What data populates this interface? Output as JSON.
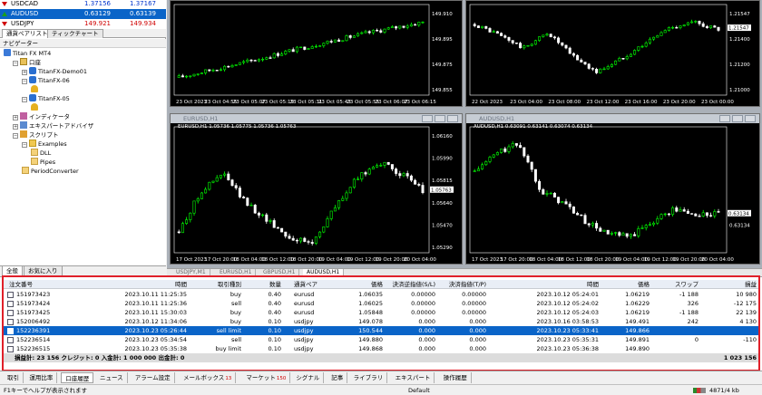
{
  "market_watch": {
    "rows": [
      {
        "symbol": "USDCAD",
        "bid": "1.37156",
        "ask": "1.37167",
        "dir": "down",
        "bid_color": "blue",
        "ask_color": "blue"
      },
      {
        "symbol": "AUDUSD",
        "bid": "0.63129",
        "ask": "0.63139",
        "dir": "up",
        "bid_color": "blue",
        "ask_color": "blue",
        "selected": true
      },
      {
        "symbol": "USDJPY",
        "bid": "149.921",
        "ask": "149.934",
        "dir": "down",
        "bid_color": "red",
        "ask_color": "red"
      }
    ],
    "tabs": [
      "通貨ペアリスト",
      "ティックチャート"
    ]
  },
  "navigator": {
    "title": "ナビゲーター",
    "tree": [
      {
        "label": "Titan FX MT4",
        "level": 0,
        "icon": "terminal-icon",
        "expander": ""
      },
      {
        "label": "口座",
        "level": 1,
        "icon": "accounts-icon",
        "expander": "−"
      },
      {
        "label": "TitanFX-Demo01",
        "level": 2,
        "icon": "server-icon",
        "expander": "+"
      },
      {
        "label": "TitanFX-06",
        "level": 2,
        "icon": "server-icon",
        "expander": "−"
      },
      {
        "label": "",
        "level": 3,
        "icon": "user-icon",
        "expander": ""
      },
      {
        "label": "TitanFX-05",
        "level": 2,
        "icon": "server-icon",
        "expander": "−"
      },
      {
        "label": "",
        "level": 3,
        "icon": "user-icon",
        "expander": ""
      },
      {
        "label": "インディケータ",
        "level": 1,
        "icon": "indicator-icon",
        "expander": "+"
      },
      {
        "label": "エキスパートアドバイザ",
        "level": 1,
        "icon": "expert-icon",
        "expander": "+"
      },
      {
        "label": "スクリプト",
        "level": 1,
        "icon": "script-icon",
        "expander": "−"
      },
      {
        "label": "Examples",
        "level": 2,
        "icon": "folder-icon",
        "expander": "−"
      },
      {
        "label": "DLL",
        "level": 3,
        "icon": "script-item-icon",
        "expander": ""
      },
      {
        "label": "Pipes",
        "level": 3,
        "icon": "script-item-icon",
        "expander": ""
      },
      {
        "label": "PeriodConverter",
        "level": 2,
        "icon": "script-item-icon",
        "expander": ""
      }
    ],
    "tabs": [
      "全般",
      "お気に入り"
    ]
  },
  "charts": [
    {
      "title": "",
      "ohlc": "",
      "time_labels": [
        "23 Oct 2023",
        "23 Oct 04:55",
        "23 Oct 05:07",
        "23 Oct 05:19",
        "23 Oct 05:31",
        "23 Oct 05:43",
        "23 Oct 05:55",
        "23 Oct 06:07",
        "23 Oct 06:15"
      ],
      "price_labels": [
        "149.910",
        "149.895",
        "149.875",
        "149.855"
      ],
      "current_price": "",
      "chart_data": {
        "type": "candlestick",
        "y_range": [
          149.845,
          149.925
        ],
        "trend": [
          149.862,
          149.868,
          149.874,
          149.88,
          149.887,
          149.893,
          149.899,
          149.905,
          149.91,
          149.915
        ],
        "current": null
      }
    },
    {
      "title": "",
      "ohlc": "",
      "time_labels": [
        "22 Oct 2023",
        "23 Oct 04:00",
        "23 Oct 08:00",
        "23 Oct 12:00",
        "23 Oct 16:00",
        "23 Oct 20:00",
        "23 Oct 00:00"
      ],
      "price_labels": [
        "1.21547",
        "1.21400",
        "1.21200",
        "1.21000"
      ],
      "current_price": "1.21547",
      "chart_data": {
        "type": "candlestick",
        "y_range": [
          1.209,
          1.217
        ],
        "trend": [
          1.2158,
          1.2148,
          1.2135,
          1.215,
          1.2128,
          1.2112,
          1.2125,
          1.214,
          1.2155,
          1.216,
          1.2153
        ],
        "current": 1.21547
      }
    },
    {
      "title": "EURUSD,H1",
      "ohlc": "EURUSD,H1  1.05736 1.05775 1.05736 1.05763",
      "time_labels": [
        "17 Oct 2023",
        "17 Oct 20:00",
        "18 Oct 04:00",
        "18 Oct 12:00",
        "18 Oct 20:00",
        "19 Oct 04:00",
        "19 Oct 12:00",
        "19 Oct 20:00",
        "20 Oct 04:00"
      ],
      "price_labels": [
        "1.06160",
        "1.05990",
        "1.05815",
        "1.05640",
        "1.05470",
        "1.05290"
      ],
      "current_price": "1.05763",
      "chart_data": {
        "type": "candlestick",
        "y_range": [
          1.0522,
          1.0624
        ],
        "trend": [
          1.054,
          1.0575,
          1.059,
          1.0565,
          1.055,
          1.0535,
          1.053,
          1.056,
          1.0585,
          1.06,
          1.059,
          1.0576
        ],
        "current": 1.05763
      }
    },
    {
      "title": "AUDUSD,H1",
      "ohlc": "AUDUSD,H1  0.63091 0.63141 0.63074 0.63134",
      "time_labels": [
        "17 Oct 2023",
        "17 Oct 20:00",
        "18 Oct 04:00",
        "18 Oct 12:00",
        "18 Oct 20:00",
        "19 Oct 04:00",
        "19 Oct 12:00",
        "19 Oct 20:00",
        "20 Oct 04:00"
      ],
      "price_labels": [
        "",
        "",
        "",
        "",
        "0.63134",
        ""
      ],
      "current_price": "0.63134",
      "chart_data": {
        "type": "candlestick",
        "y_range": [
          0.625,
          0.644
        ],
        "trend": [
          0.638,
          0.641,
          0.6425,
          0.635,
          0.633,
          0.63,
          0.628,
          0.6275,
          0.63,
          0.632,
          0.631,
          0.6313
        ],
        "current": 0.63134
      }
    }
  ],
  "chart_tabs": [
    "USDJPY,M1",
    "EURUSD,H1",
    "GBPUSD,H1",
    "AUDUSD,H1"
  ],
  "history": {
    "columns": [
      "注文番号",
      "時間",
      "取引種別",
      "数量",
      "通貨ペア",
      "価格",
      "決済逆指値(S/L)",
      "決済指値(T/P)",
      "時間",
      "価格",
      "スワップ",
      "損益"
    ],
    "rows": [
      {
        "id": "151973423",
        "open_time": "2023.10.11 11:25:35",
        "type": "buy",
        "size": "0.40",
        "symbol": "eurusd",
        "price": "1.06035",
        "sl": "0.00000",
        "tp": "0.00000",
        "close_time": "2023.10.12 05:24:01",
        "close_price": "1.06219",
        "swap": "-1 188",
        "profit": "10 980"
      },
      {
        "id": "151973424",
        "open_time": "2023.10.11 11:25:36",
        "type": "sell",
        "size": "0.40",
        "symbol": "eurusd",
        "price": "1.06025",
        "sl": "0.00000",
        "tp": "0.00000",
        "close_time": "2023.10.12 05:24:02",
        "close_price": "1.06229",
        "swap": "326",
        "profit": "-12 175"
      },
      {
        "id": "151973425",
        "open_time": "2023.10.11 15:30:03",
        "type": "buy",
        "size": "0.40",
        "symbol": "eurusd",
        "price": "1.05848",
        "sl": "0.00000",
        "tp": "0.00000",
        "close_time": "2023.10.12 05:24:03",
        "close_price": "1.06219",
        "swap": "-1 188",
        "profit": "22 139"
      },
      {
        "id": "152006492",
        "open_time": "2023.10.12 11:34:06",
        "type": "buy",
        "size": "0.10",
        "symbol": "usdjpy",
        "price": "149.078",
        "sl": "0.000",
        "tp": "0.000",
        "close_time": "2023.10.16 03:58:53",
        "close_price": "149.491",
        "swap": "242",
        "profit": "4 130"
      },
      {
        "id": "152236391",
        "open_time": "2023.10.23 05:26:44",
        "type": "sell limit",
        "size": "0.10",
        "symbol": "usdjpy",
        "price": "150.544",
        "sl": "0.000",
        "tp": "0.000",
        "close_time": "2023.10.23 05:33:41",
        "close_price": "149.866",
        "swap": "",
        "profit": "",
        "selected": true
      },
      {
        "id": "152236514",
        "open_time": "2023.10.23 05:34:54",
        "type": "sell",
        "size": "0.10",
        "symbol": "usdjpy",
        "price": "149.880",
        "sl": "0.000",
        "tp": "0.000",
        "close_time": "2023.10.23 05:35:31",
        "close_price": "149.891",
        "swap": "0",
        "profit": "-110"
      },
      {
        "id": "152236515",
        "open_time": "2023.10.23 05:35:38",
        "type": "buy limit",
        "size": "0.10",
        "symbol": "usdjpy",
        "price": "149.868",
        "sl": "0.000",
        "tp": "0.000",
        "close_time": "2023.10.23 05:36:38",
        "close_price": "149.890",
        "swap": "",
        "profit": ""
      }
    ],
    "summary": "損益計: 23 156  クレジット: 0  入金計: 1 000 000  出金計: 0",
    "summary_total": "1 023 156"
  },
  "terminal_tabs": [
    {
      "label": "取引",
      "badge": ""
    },
    {
      "label": "運用比率",
      "badge": ""
    },
    {
      "label": "口座履歴",
      "badge": "",
      "active": true
    },
    {
      "label": "ニュース",
      "badge": ""
    },
    {
      "label": "アラーム設定",
      "badge": ""
    },
    {
      "label": "メールボックス",
      "badge": "13"
    },
    {
      "label": "マーケット",
      "badge": "150"
    },
    {
      "label": "シグナル",
      "badge": ""
    },
    {
      "label": "記事",
      "badge": ""
    },
    {
      "label": "ライブラリ",
      "badge": ""
    },
    {
      "label": "エキスパート",
      "badge": ""
    },
    {
      "label": "操作履歴",
      "badge": ""
    }
  ],
  "status": {
    "help": "F1キーでヘルプが表示されます",
    "profile": "Default",
    "traffic": "4871/4 kb"
  },
  "colors": {
    "bull": "#00ff00",
    "bear": "#ffffff",
    "selection": "#0a64c8",
    "highlight_box": "#e0202a"
  }
}
